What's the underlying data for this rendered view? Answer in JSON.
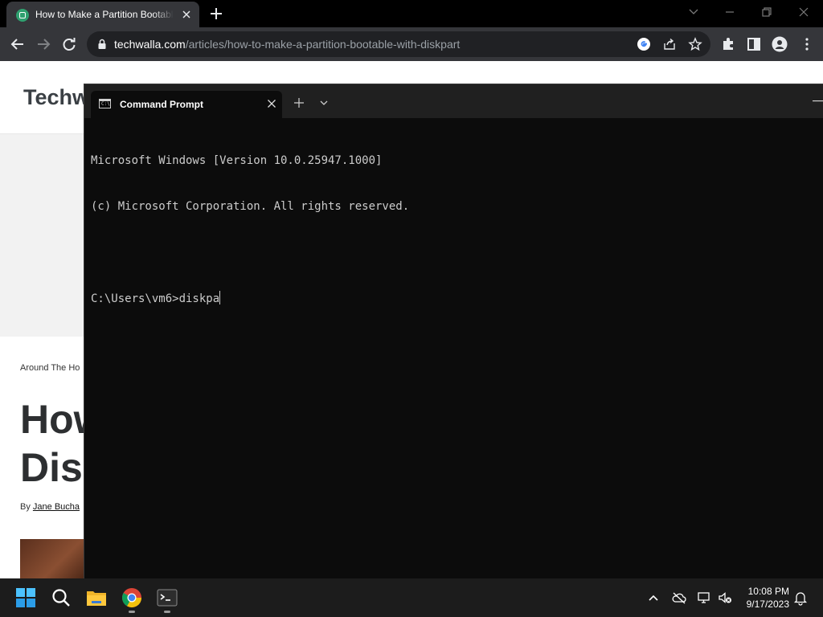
{
  "browser": {
    "tab_title": "How to Make a Partition Bootable with Diskpart",
    "url_host": "techwalla.com",
    "url_path": "/articles/how-to-make-a-partition-bootable-with-diskpart"
  },
  "webpage": {
    "logo": "Techw",
    "breadcrumb": "Around The Ho",
    "headline_lines": [
      "How",
      "Disk"
    ],
    "byline_prefix": "By",
    "byline_author": "Jane Bucha"
  },
  "terminal": {
    "tab_title": "Command Prompt",
    "lines": [
      "Microsoft Windows [Version 10.0.25947.1000]",
      "(c) Microsoft Corporation. All rights reserved.",
      "",
      "C:\\Users\\vm6>diskpa"
    ]
  },
  "taskbar": {
    "time": "10:08 PM",
    "date": "9/17/2023"
  },
  "colors": {
    "terminal_bg": "#0c0c0c",
    "terminal_text": "#cccccc",
    "chrome_toolbar": "#35363a",
    "taskbar": "#1c1c1c"
  }
}
